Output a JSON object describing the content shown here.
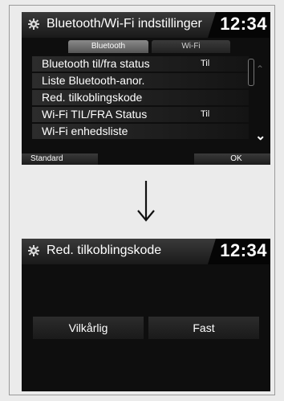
{
  "screen1": {
    "title": "Bluetooth/Wi-Fi indstillinger",
    "clock": "12:34",
    "tabs": [
      {
        "label": "Bluetooth",
        "active": true
      },
      {
        "label": "Wi-Fi",
        "active": false
      }
    ],
    "rows": [
      {
        "label": "Bluetooth til/fra status",
        "value": "Til"
      },
      {
        "label": "Liste Bluetooth-anor.",
        "value": ""
      },
      {
        "label": "Red. tilkoblingskode",
        "value": ""
      },
      {
        "label": "Wi-Fi TIL/FRA Status",
        "value": "Til"
      },
      {
        "label": "Wi-Fi enhedsliste",
        "value": ""
      }
    ],
    "footer": {
      "standard_label": "Standard",
      "ok_label": "OK"
    }
  },
  "screen2": {
    "title": "Red. tilkoblingskode",
    "clock": "12:34",
    "options": [
      {
        "label": "Vilkårlig"
      },
      {
        "label": "Fast"
      }
    ]
  },
  "icons": {
    "settings": "gear-icon",
    "transition": "arrow-down-icon",
    "scroll_up": "chevron-up-icon",
    "scroll_down": "chevron-down-icon"
  },
  "colors": {
    "screen_bg": "#0e0e0e",
    "page_bg": "#ebebeb",
    "text": "#ffffff"
  }
}
